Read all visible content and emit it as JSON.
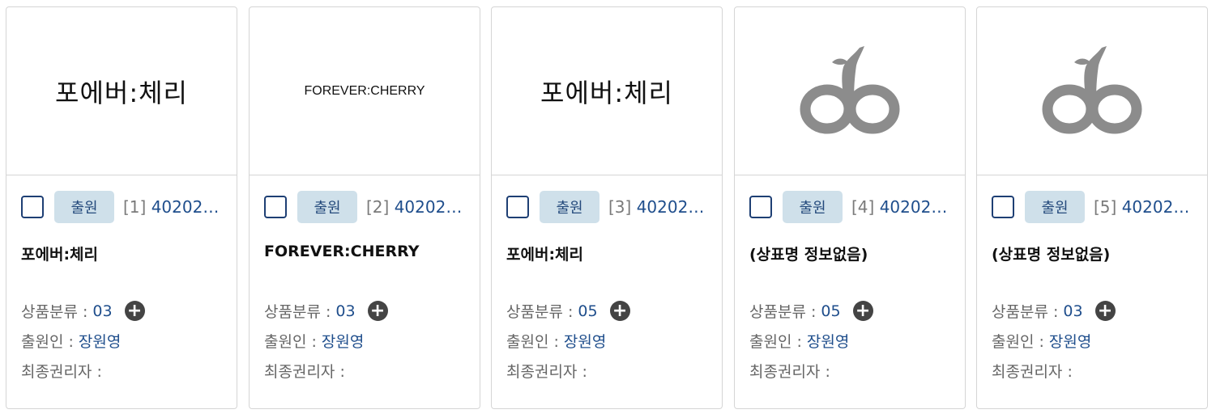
{
  "cards": [
    {
      "thumb_text": "포에버:체리",
      "badge": "출원",
      "index": "[1]",
      "app_no": "40202…",
      "name": "포에버:체리",
      "class_label": "상품분류 :",
      "class_value": "03",
      "applicant_label": "출원인 :",
      "applicant_value": "장원영",
      "owner_label": "최종권리자 :",
      "owner_value": ""
    },
    {
      "thumb_text": "FOREVER:CHERRY",
      "badge": "출원",
      "index": "[2]",
      "app_no": "40202…",
      "name": "FOREVER:CHERRY",
      "class_label": "상품분류 :",
      "class_value": "03",
      "applicant_label": "출원인 :",
      "applicant_value": "장원영",
      "owner_label": "최종권리자 :",
      "owner_value": ""
    },
    {
      "thumb_text": "포에버:체리",
      "badge": "출원",
      "index": "[3]",
      "app_no": "40202…",
      "name": "포에버:체리",
      "class_label": "상품분류 :",
      "class_value": "05",
      "applicant_label": "출원인 :",
      "applicant_value": "장원영",
      "owner_label": "최종권리자 :",
      "owner_value": ""
    },
    {
      "badge": "출원",
      "index": "[4]",
      "app_no": "40202…",
      "name": "(상표명 정보없음)",
      "class_label": "상품분류 :",
      "class_value": "05",
      "applicant_label": "출원인 :",
      "applicant_value": "장원영",
      "owner_label": "최종권리자 :",
      "owner_value": ""
    },
    {
      "badge": "출원",
      "index": "[5]",
      "app_no": "40202…",
      "name": "(상표명 정보없음)",
      "class_label": "상품분류 :",
      "class_value": "03",
      "applicant_label": "출원인 :",
      "applicant_value": "장원영",
      "owner_label": "최종권리자 :",
      "owner_value": ""
    }
  ],
  "colors": {
    "badge_bg": "#cfe0ea",
    "link_blue": "#1f4e8c",
    "checkbox_border": "#1e3f74",
    "logo_gray": "#8c8c8c"
  },
  "icons": {
    "plus": "plus-circle-icon",
    "logo": "cherry-logo-icon"
  }
}
